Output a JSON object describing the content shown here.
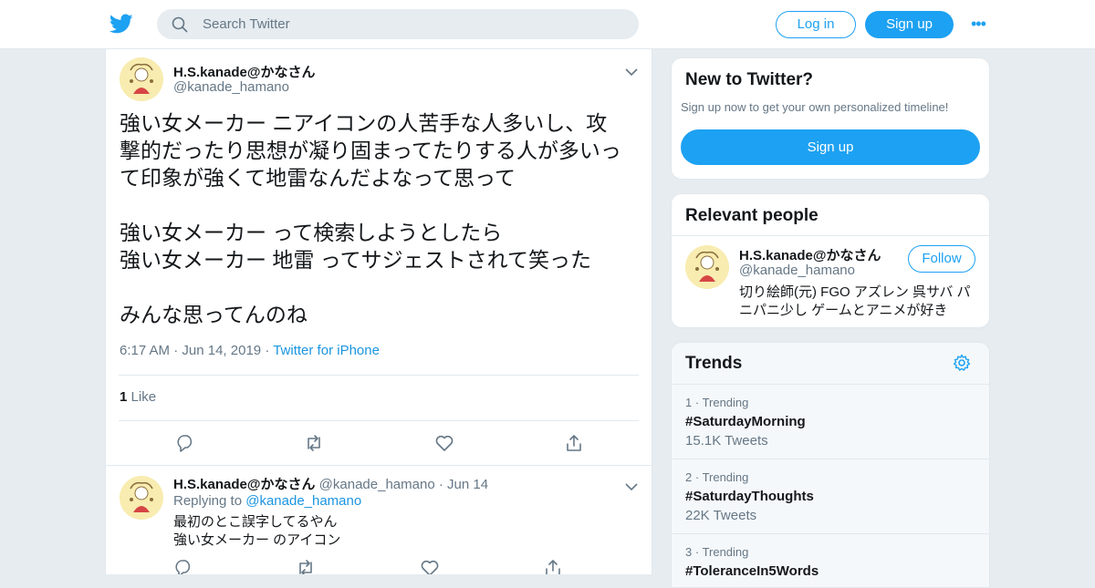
{
  "search": {
    "placeholder": "Search Twitter"
  },
  "header": {
    "login_label": "Log in",
    "signup_label": "Sign up",
    "more_label": "•••"
  },
  "tweet": {
    "name": "H.S.kanade@かなさん",
    "handle": "@kanade_hamano",
    "text_lines": [
      "強い女メーカー ニアイコンの人苦手な人多いし、攻",
      "撃的だったり思想が凝り固まってたりする人が多いっ",
      "て印象が強くて地雷なんだよなって思って",
      "",
      "強い女メーカー って検索しようとしたら",
      "強い女メーカー 地雷 ってサジェストされて笑った",
      "",
      "みんな思ってんのね"
    ],
    "time": "6:17 AM",
    "date": "Jun 14, 2019",
    "source": "Twitter for iPhone",
    "like_count": "1",
    "like_label": "Like"
  },
  "reply": {
    "name": "H.S.kanade@かなさん",
    "handle": "@kanade_hamano",
    "date": "Jun 14",
    "replying_label": "Replying to",
    "replying_to": "@kanade_hamano",
    "lines": [
      "最初のとこ誤字してるやん",
      "強い女メーカー のアイコン"
    ]
  },
  "new_to_twitter": {
    "title": "New to Twitter?",
    "subtitle": "Sign up now to get your own personalized timeline!",
    "signup_label": "Sign up"
  },
  "relevant_people": {
    "title": "Relevant people",
    "name": "H.S.kanade@かなさん",
    "handle": "@kanade_hamano",
    "follow_label": "Follow",
    "bio_lines": [
      "切り絵師(元) FGO アズレン 呉サバ パ",
      "ニパニ少し ゲームとアニメが好き"
    ]
  },
  "trends": {
    "title": "Trends",
    "items": [
      {
        "rank": "1",
        "label": "Trending",
        "tag": "#SaturdayMorning",
        "count": "15.1K Tweets"
      },
      {
        "rank": "2",
        "label": "Trending",
        "tag": "#SaturdayThoughts",
        "count": "22K Tweets"
      },
      {
        "rank": "3",
        "label": "Trending",
        "tag": "#ToleranceIn5Words",
        "count": ""
      }
    ]
  },
  "colors": {
    "accent": "#1da1f2",
    "link": "#1b95e0",
    "muted": "#657786",
    "background": "#e6ecf0"
  },
  "icons": [
    "twitter-bird-icon",
    "search-icon",
    "chevron-down-icon",
    "reply-icon",
    "retweet-icon",
    "like-icon",
    "share-icon",
    "gear-icon"
  ]
}
